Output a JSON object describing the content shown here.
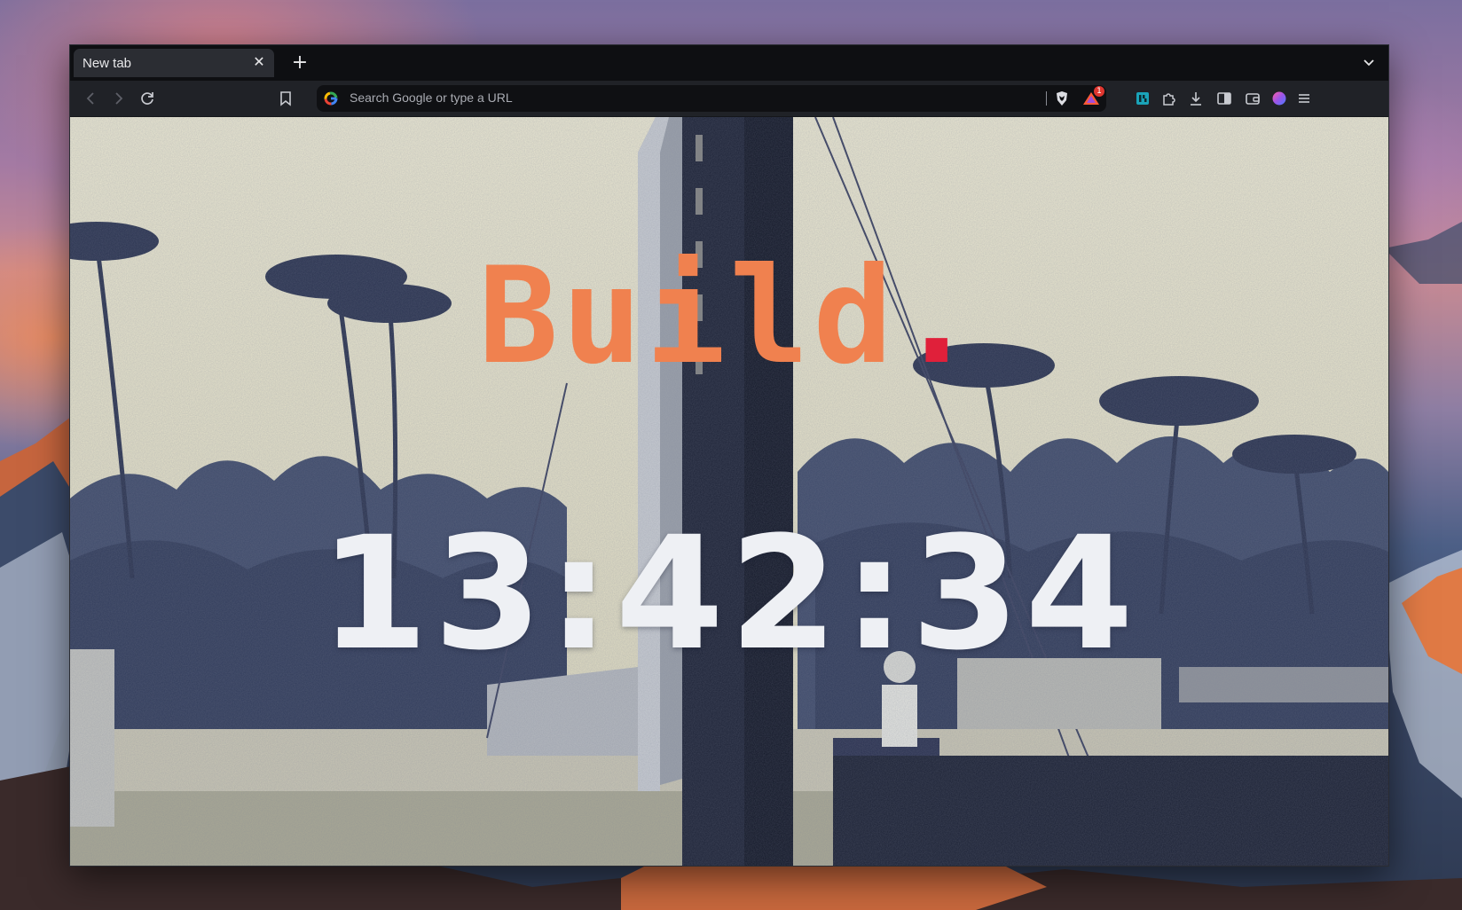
{
  "browser": {
    "tab": {
      "title": "New tab",
      "close_glyph": "✕"
    },
    "new_tab_glyph": "+",
    "toolbar": {
      "back_icon": "chevron-left-icon",
      "forward_icon": "chevron-right-icon",
      "reload_icon": "reload-icon",
      "bookmark_icon": "bookmark-icon",
      "search_placeholder": "Search Google or type a URL",
      "rewards_badge": "1",
      "extensions": [
        "leo-extension-icon",
        "puzzle-icon",
        "download-icon",
        "sidebar-icon",
        "wallet-icon",
        "profile-avatar",
        "menu-icon"
      ]
    }
  },
  "new_tab_page": {
    "headline_word": "Build",
    "headline_dot": ".",
    "clock": "13:42:34"
  },
  "colors": {
    "headline": "#f0814f",
    "dot": "#e0203a",
    "clock": "#eef0f4",
    "urlbar_bg": "#0f1013",
    "toolbar_bg": "#202227",
    "tabstrip_bg": "#0e0f12",
    "active_tab_bg": "#2b2d33"
  }
}
